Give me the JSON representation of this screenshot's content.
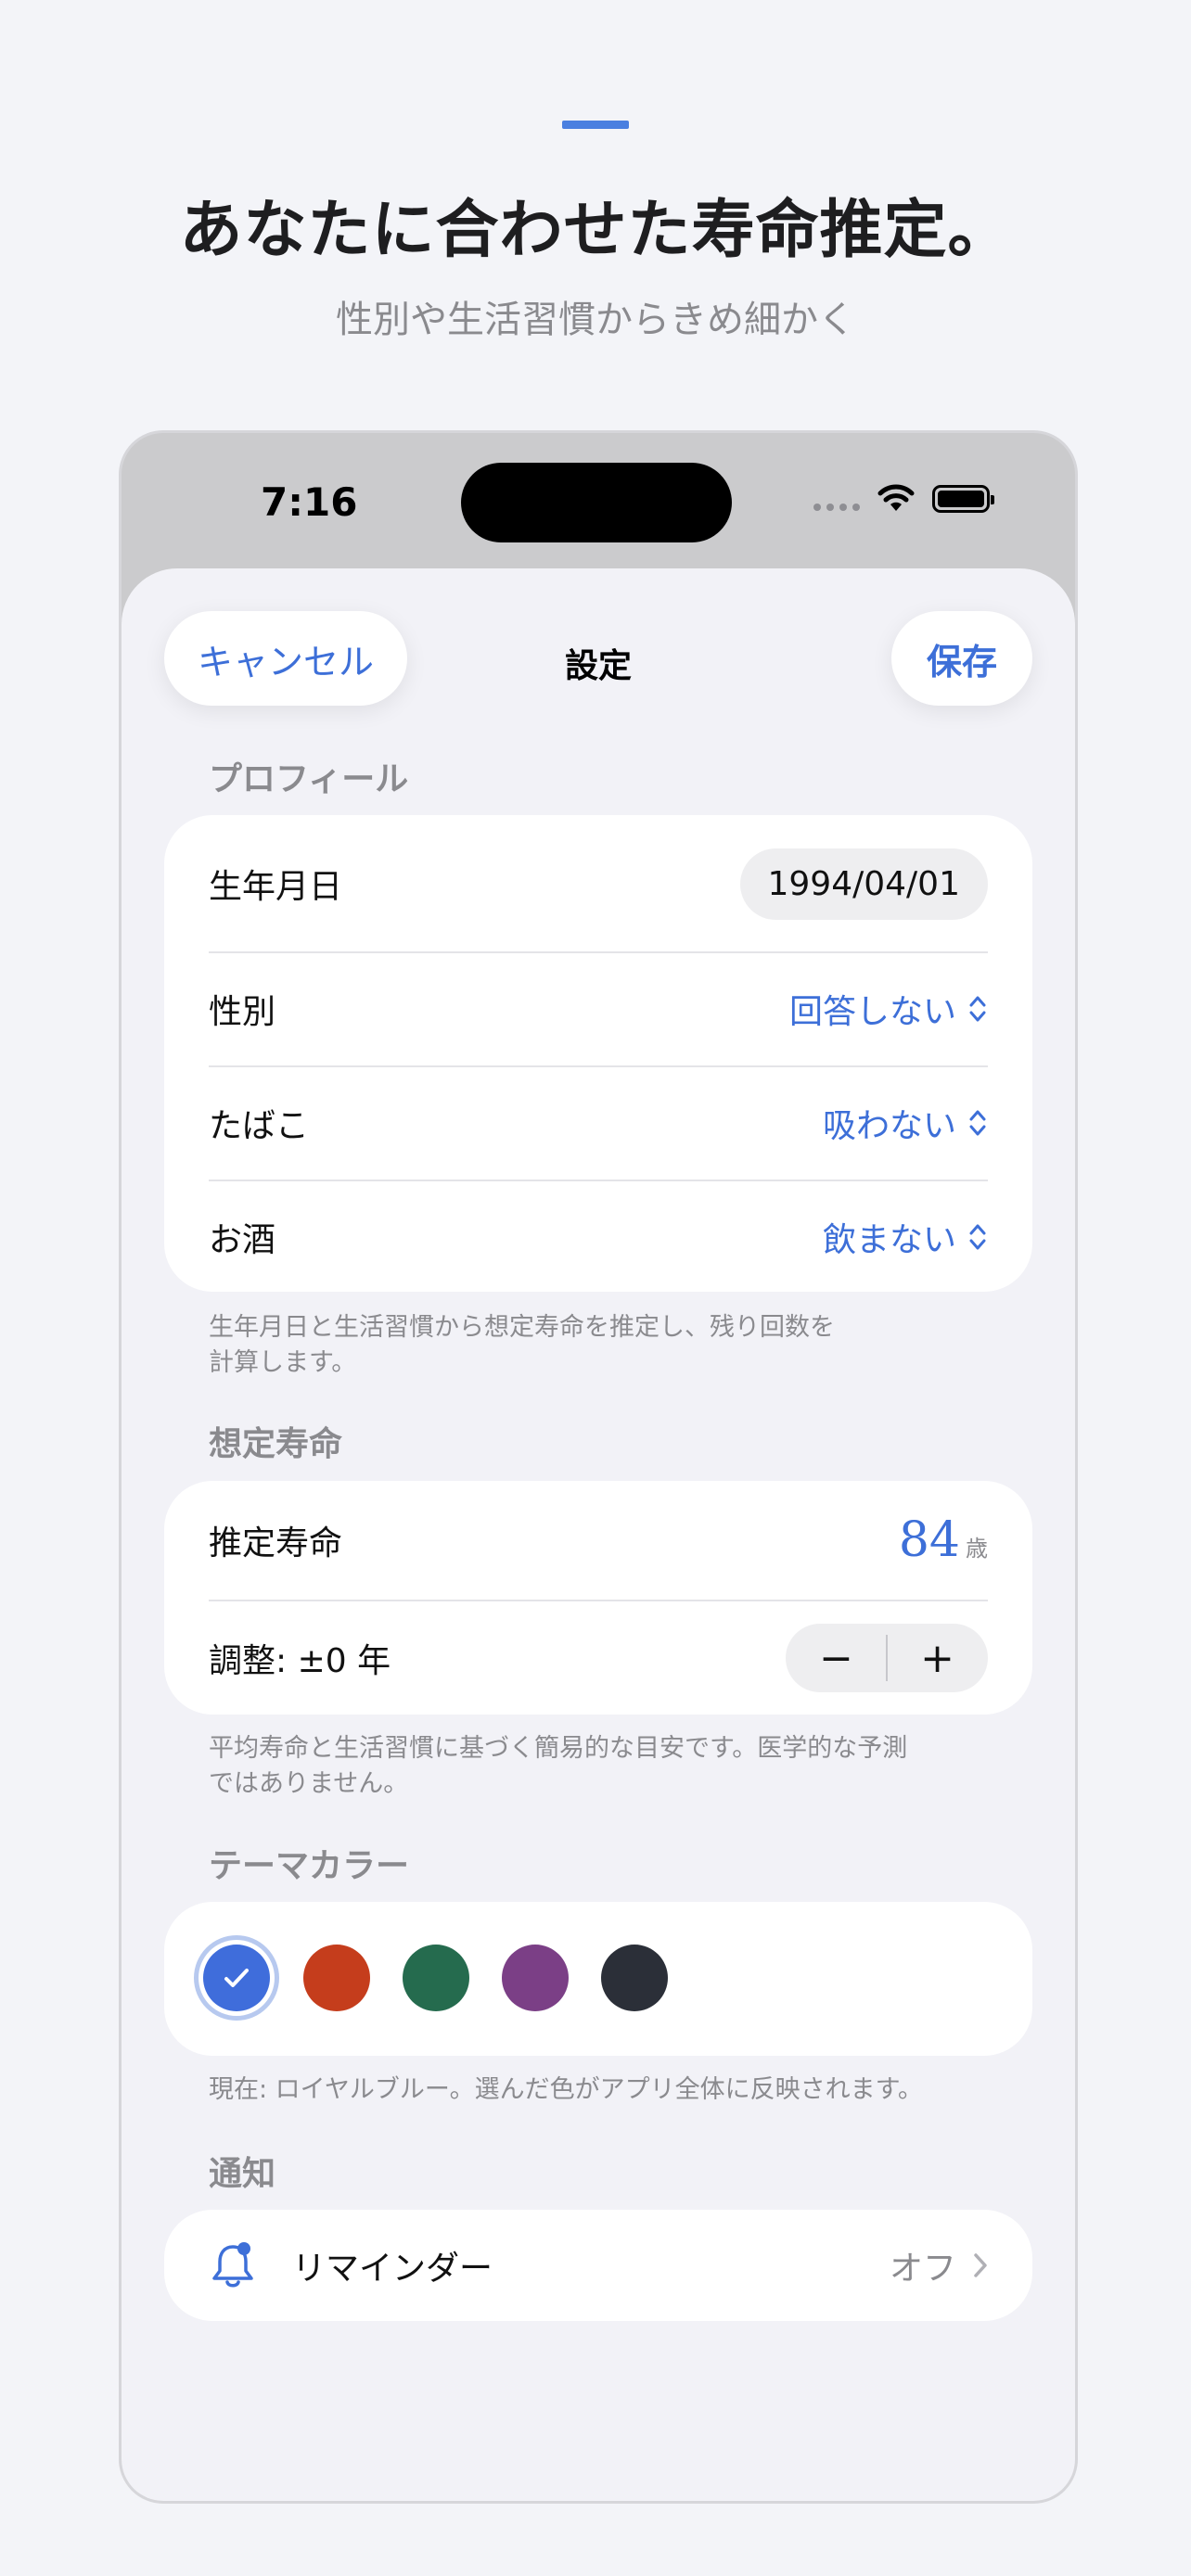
{
  "promo": {
    "headline": "あなたに合わせた寿命推定。",
    "subline": "性別や生活習慣からきめ細かく"
  },
  "status_bar": {
    "time": "7:16"
  },
  "nav": {
    "cancel_label": "キャンセル",
    "title": "設定",
    "save_label": "保存"
  },
  "profile": {
    "header": "プロフィール",
    "birthdate": {
      "label": "生年月日",
      "value": "1994/04/01"
    },
    "gender": {
      "label": "性別",
      "value": "回答しない"
    },
    "smoking": {
      "label": "たばこ",
      "value": "吸わない"
    },
    "alcohol": {
      "label": "お酒",
      "value": "飲まない"
    },
    "footnote_line1": "生年月日と生活習慣から想定寿命を推定し、残り回数を",
    "footnote_line2": "計算します。"
  },
  "life_expectancy": {
    "header": "想定寿命",
    "estimate": {
      "label": "推定寿命",
      "value": "84",
      "unit": "歳"
    },
    "adjust": {
      "label": "調整: ±0 年",
      "minus": "−",
      "plus": "+"
    },
    "footnote_line1": "平均寿命と生活習慣に基づく簡易的な目安です。医学的な予測",
    "footnote_line2": "ではありません。"
  },
  "theme": {
    "header": "テーマカラー",
    "selected_index": 0,
    "colors": [
      "#3f6ddb",
      "#c53d1c",
      "#256b4e",
      "#7b3f86",
      "#2b2f38"
    ],
    "footnote": "現在: ロイヤルブルー。選んだ色がアプリ全体に反映されます。"
  },
  "notifications": {
    "header": "通知",
    "reminder": {
      "label": "リマインダー",
      "value": "オフ",
      "icon": "bell-badge-icon"
    }
  }
}
